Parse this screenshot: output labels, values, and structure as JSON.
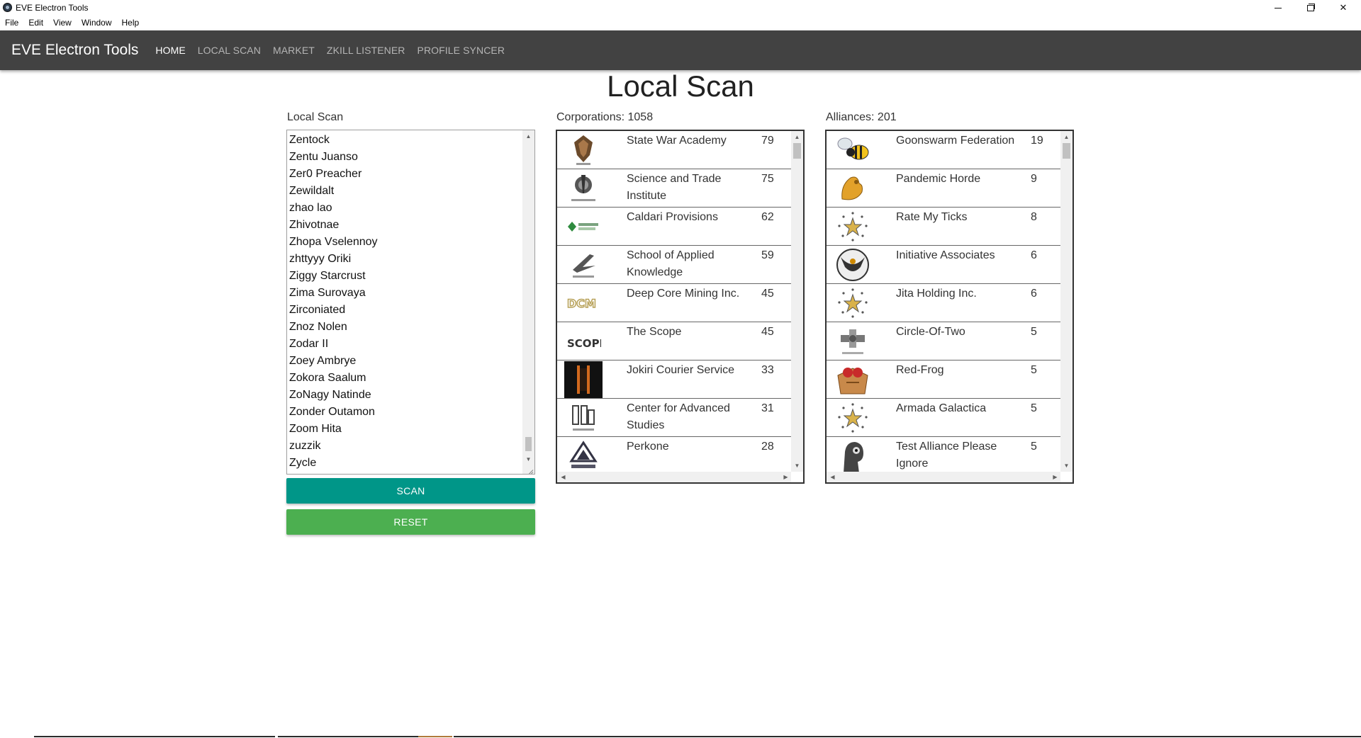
{
  "window": {
    "title": "EVE Electron Tools",
    "controls": {
      "minimize": "minimize",
      "maximize": "restore",
      "close": "✕"
    }
  },
  "menu": [
    "File",
    "Edit",
    "View",
    "Window",
    "Help"
  ],
  "navbar": {
    "brand": "EVE Electron Tools",
    "links": [
      {
        "label": "HOME",
        "active": true
      },
      {
        "label": "LOCAL SCAN",
        "active": false
      },
      {
        "label": "MARKET",
        "active": false
      },
      {
        "label": "ZKILL LISTENER",
        "active": false
      },
      {
        "label": "PROFILE SYNCER",
        "active": false
      }
    ]
  },
  "page_title": "Local Scan",
  "local_scan": {
    "label": "Local Scan",
    "lines": [
      "Zentock",
      "Zentu Juanso",
      "Zer0 Preacher",
      "Zewildalt",
      "zhao lao",
      "Zhivotnae",
      "Zhopa Vselennoy",
      "zhttyyy Oriki",
      "Ziggy Starcrust",
      "Zima Surovaya",
      "Zirconiated",
      "Znoz Nolen",
      "Zodar II",
      "Zoey Ambrye",
      "Zokora Saalum",
      "ZoNagy Natinde",
      "Zonder Outamon",
      "Zoom Hita",
      "zuzzik",
      "Zycle"
    ],
    "scan_button": "SCAN",
    "reset_button": "RESET"
  },
  "corporations": {
    "label": "Corporations: 1058",
    "rows": [
      {
        "name": "State War Academy",
        "count": "79",
        "logo": "state-war-academy-logo"
      },
      {
        "name": "Science and Trade Institute",
        "count": "75",
        "logo": "science-trade-institute-logo"
      },
      {
        "name": "Caldari Provisions",
        "count": "62",
        "logo": "caldari-provisions-logo"
      },
      {
        "name": "School of Applied Knowledge",
        "count": "59",
        "logo": "school-applied-knowledge-logo"
      },
      {
        "name": "Deep Core Mining Inc.",
        "count": "45",
        "logo": "deep-core-mining-logo"
      },
      {
        "name": "The Scope",
        "count": "45",
        "logo": "the-scope-logo"
      },
      {
        "name": "Jokiri Courier Service",
        "count": "33",
        "logo": "jokiri-courier-logo"
      },
      {
        "name": "Center for Advanced Studies",
        "count": "31",
        "logo": "center-advanced-studies-logo"
      },
      {
        "name": "Perkone",
        "count": "28",
        "logo": "perkone-logo"
      }
    ]
  },
  "alliances": {
    "label": "Alliances: 201",
    "rows": [
      {
        "name": "Goonswarm Federation",
        "count": "19",
        "logo": "goonswarm-bee-logo"
      },
      {
        "name": "Pandemic Horde",
        "count": "9",
        "logo": "pandemic-horde-logo"
      },
      {
        "name": "Rate My Ticks",
        "count": "8",
        "logo": "default-star-logo"
      },
      {
        "name": "Initiative Associates",
        "count": "6",
        "logo": "initiative-associates-logo"
      },
      {
        "name": "Jita Holding Inc.",
        "count": "6",
        "logo": "default-star-logo"
      },
      {
        "name": "Circle-Of-Two",
        "count": "5",
        "logo": "circle-of-two-logo"
      },
      {
        "name": "Red-Frog",
        "count": "5",
        "logo": "red-frog-logo"
      },
      {
        "name": "Armada Galactica",
        "count": "5",
        "logo": "default-star-logo"
      },
      {
        "name": "Test Alliance Please Ignore",
        "count": "5",
        "logo": "test-alliance-logo"
      }
    ]
  },
  "colors": {
    "navbar_bg": "#424242",
    "scan_button": "#009688",
    "reset_button": "#4caf50"
  }
}
